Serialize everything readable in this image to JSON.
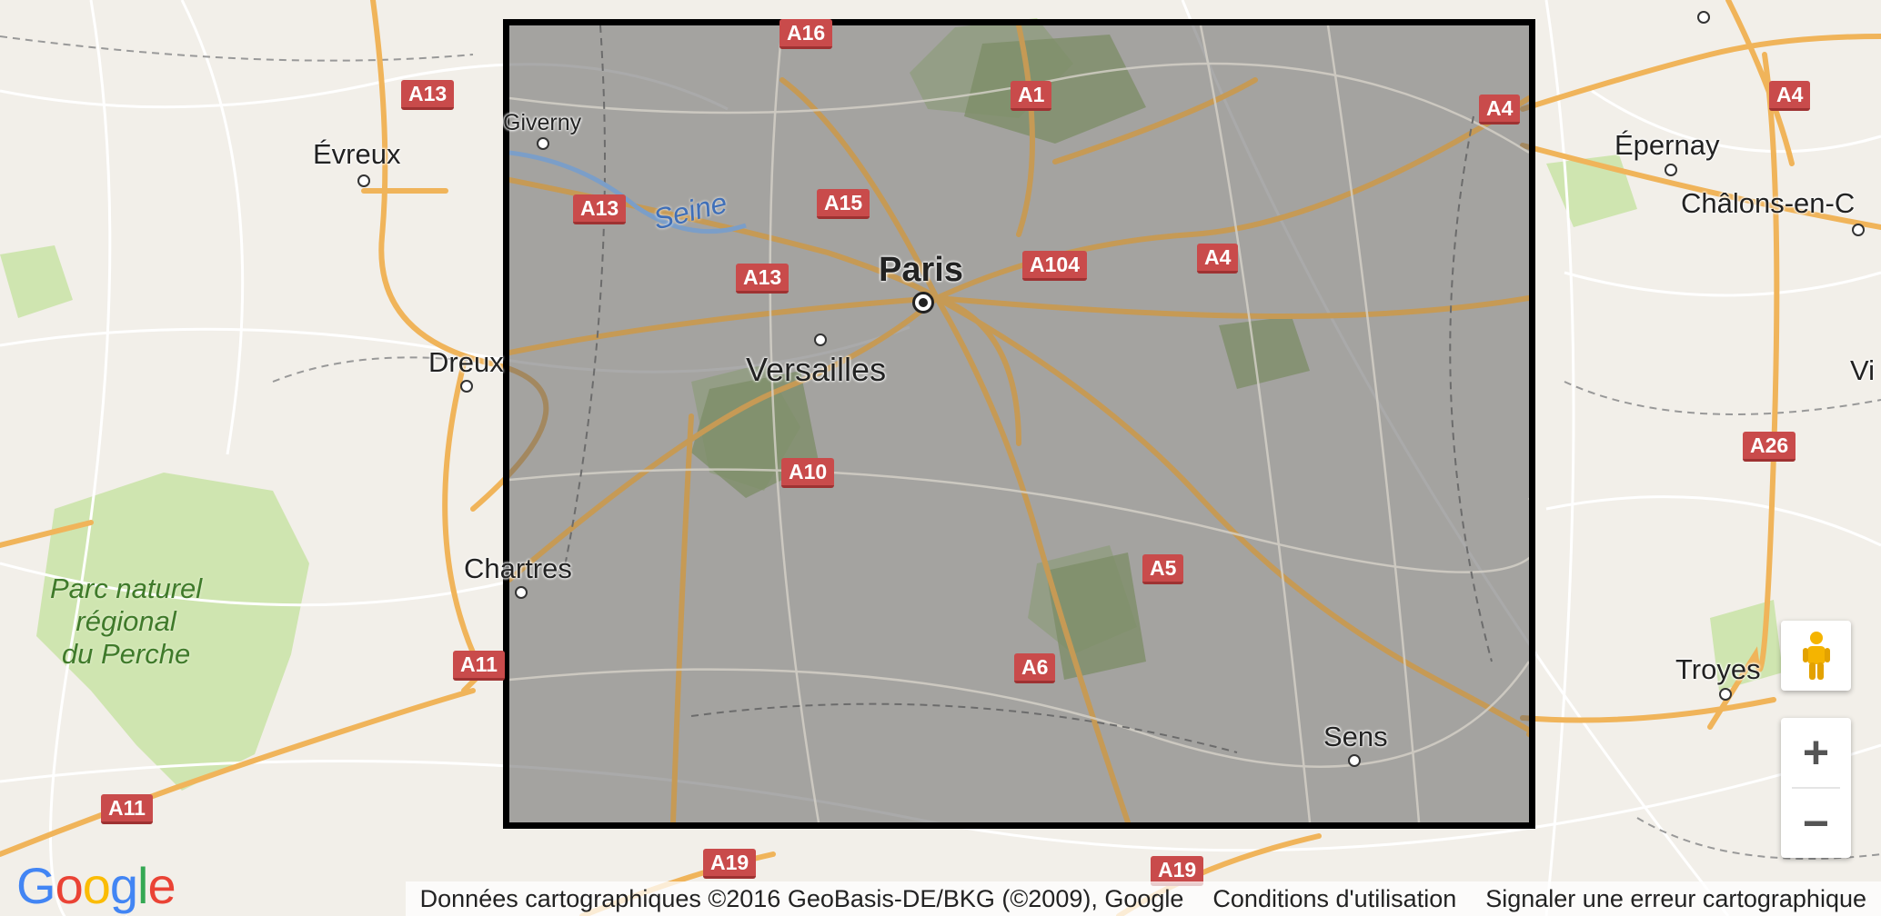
{
  "colors": {
    "land": "#f2efe9",
    "park": "#cfe5b0",
    "motorway": "#f0b45a",
    "road": "#ffffff",
    "shield": "#c94b4b",
    "overlay": "#646464",
    "water": "#3f6fb8"
  },
  "cities": [
    {
      "id": "paris",
      "name": "Paris"
    },
    {
      "id": "versailles",
      "name": "Versailles"
    },
    {
      "id": "evreux",
      "name": "Évreux"
    },
    {
      "id": "dreux",
      "name": "Dreux"
    },
    {
      "id": "chartres",
      "name": "Chartres"
    },
    {
      "id": "giverny",
      "name": "Giverny"
    },
    {
      "id": "epernay",
      "name": "Épernay"
    },
    {
      "id": "chalons",
      "name": "Châlons-en-C"
    },
    {
      "id": "troyes",
      "name": "Troyes"
    },
    {
      "id": "sens",
      "name": "Sens"
    },
    {
      "id": "vi",
      "name": "Vi"
    }
  ],
  "water": {
    "seine": "Seine"
  },
  "park": {
    "line1": "Parc naturel",
    "line2": "régional",
    "line3": "du Perche"
  },
  "routes": [
    "A16",
    "A13",
    "A1",
    "A4",
    "A13",
    "A15",
    "A13",
    "A104",
    "A4",
    "A10",
    "A5",
    "A6",
    "A11",
    "A11",
    "A19",
    "A19",
    "A4",
    "A26"
  ],
  "footer": {
    "data_credit": "Données cartographiques ©2016 GeoBasis-DE/BKG (©2009), Google",
    "terms": "Conditions d'utilisation",
    "report": "Signaler une erreur cartographique"
  },
  "logo": {
    "g": "G",
    "o1": "o",
    "o2": "o",
    "g2": "g",
    "l": "l",
    "e": "e"
  },
  "controls": {
    "zoom_in": "+",
    "zoom_out": "−"
  }
}
